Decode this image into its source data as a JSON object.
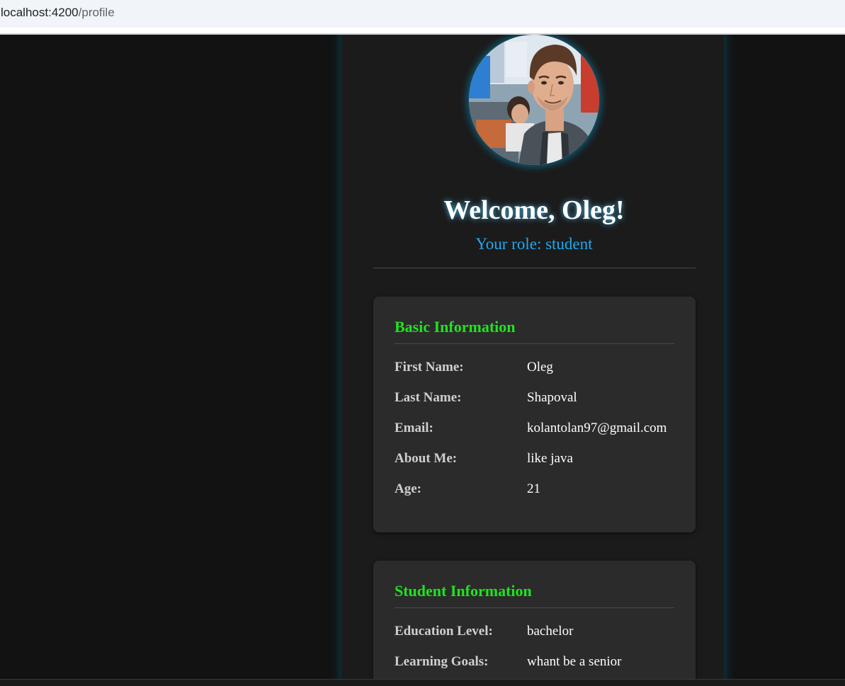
{
  "browser": {
    "url_host": "localhost:4200",
    "url_path": "/profile"
  },
  "profile": {
    "welcome": "Welcome, Oleg!",
    "role": "Your role: student"
  },
  "basic_info": {
    "title": "Basic Information",
    "rows": [
      {
        "label": "First Name:",
        "value": "Oleg"
      },
      {
        "label": "Last Name:",
        "value": "Shapoval"
      },
      {
        "label": "Email:",
        "value": "kolantolan97@gmail.com"
      },
      {
        "label": "About Me:",
        "value": "like java"
      },
      {
        "label": "Age:",
        "value": "21"
      }
    ]
  },
  "student_info": {
    "title": "Student Information",
    "rows": [
      {
        "label": "Education Level:",
        "value": "bachelor"
      },
      {
        "label": "Learning Goals:",
        "value": "whant be a senior"
      }
    ]
  },
  "colors": {
    "page_bg": "#121212",
    "panel_bg": "#1b1b1b",
    "card_bg": "#2b2b2b",
    "section_title": "#1ee51e",
    "role_text": "#1eaaf1",
    "glow": "#00aae6"
  }
}
